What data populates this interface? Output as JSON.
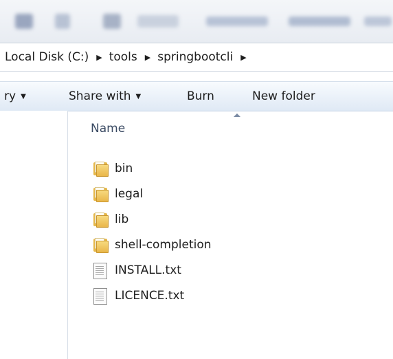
{
  "address": {
    "segments": [
      "Local Disk (C:)",
      "tools",
      "springbootcli"
    ]
  },
  "commandbar": {
    "library_partial": "ry",
    "share_with": "Share with",
    "burn": "Burn",
    "new_folder": "New folder"
  },
  "content": {
    "column_name": "Name",
    "items": [
      {
        "name": "bin",
        "icon": "folder-icon"
      },
      {
        "name": "legal",
        "icon": "folder-icon"
      },
      {
        "name": "lib",
        "icon": "folder-icon"
      },
      {
        "name": "shell-completion",
        "icon": "folder-icon"
      },
      {
        "name": "INSTALL.txt",
        "icon": "text-file-icon"
      },
      {
        "name": "LICENCE.txt",
        "icon": "text-file-icon"
      }
    ]
  },
  "colors": {
    "command_bar_top": "#f8fbfe",
    "command_bar_bottom": "#dfe9f5",
    "folder": "#e9b64a",
    "header_text": "#3a4a63"
  }
}
